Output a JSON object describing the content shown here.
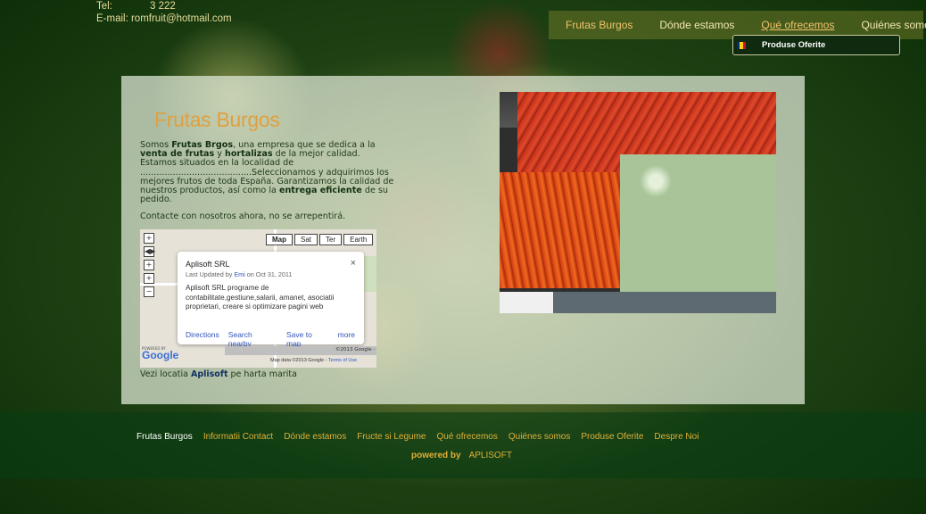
{
  "header": {
    "tel_label": "Tel:",
    "tel_value": "3 222",
    "email": "E-mail: romfruit@hotmail.com"
  },
  "topnav": {
    "items": [
      "Frutas Burgos",
      "Dónde estamos",
      "Qué ofrecemos",
      "Quiénes somos"
    ],
    "active": "Qué ofrecemos"
  },
  "submenu": {
    "item": "Produse Oferite",
    "flag_colors": [
      "#002b7f",
      "#fcd116",
      "#ce1126"
    ]
  },
  "main": {
    "title": "Frutas Burgos",
    "intro_1": "Somos ",
    "company": "Frutas Brgos",
    "intro_2": ", una empresa  que se dedica a la ",
    "bold_1": "venta de frutas",
    "intro_3": " y ",
    "bold_2": "hortalizas",
    "intro_4": " de la mejor calidad. Estamos situados en la localidad de .........................................Seleccionamos y adquirimos los mejores frutos de toda España. Garantizamos la calidad de nuestros productos, así como la ",
    "bold_3": "entrega eficiente",
    "intro_5": " de su pedido.",
    "cta": "Contacte con nosotros ahora, no se arrepentirá.",
    "map_caption_1": "Vezi locatia ",
    "map_caption_brand": "Aplisoft",
    "map_caption_2": " pe harta marita"
  },
  "map": {
    "types": [
      "Map",
      "Sat",
      "Ter",
      "Earth"
    ],
    "zoom_controls": [
      "+",
      "◀▶",
      "+",
      "+",
      "−"
    ],
    "info_title": "Aplisoft SRL",
    "info_meta_1": "Last Updated by ",
    "info_meta_user": "Emi",
    "info_meta_2": " on Oct 31, 2011",
    "info_desc": "Aplisoft SRL programe de contabilitate,gestiune,salarii, amanet, asociatii proprietari, creare si optimizare pagini web",
    "links": [
      "Directions",
      "Search nearby",
      "Save to map",
      "more"
    ],
    "logo": "Google",
    "powered": "POWERED BY",
    "copyright": "©2013 Google -",
    "attribution": "Map data ©2013 Google - ",
    "terms": "Terms of Use",
    "close": "×"
  },
  "footer": {
    "links": [
      "Frutas Burgos",
      "Informatii Contact",
      "Dónde estamos",
      "Fructe si Legume",
      "Qué ofrecemos",
      "Quiénes somos",
      "Produse Oferite",
      "Despre Noi"
    ],
    "powered_by": "powered by",
    "brand": "APLISOFT"
  }
}
